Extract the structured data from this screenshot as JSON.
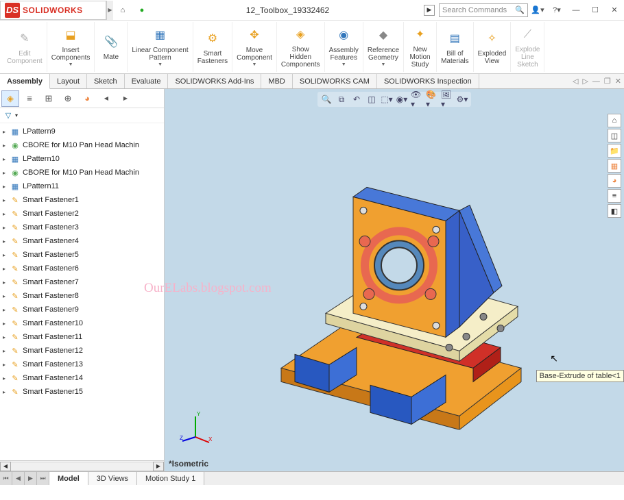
{
  "title": "12_Toolbox_19332462",
  "logo": {
    "text": "SOLIDWORKS"
  },
  "search_placeholder": "Search Commands",
  "ribbon": [
    {
      "label": "Edit\nComponent",
      "disabled": true
    },
    {
      "label": "Insert\nComponents"
    },
    {
      "label": "Mate"
    },
    {
      "label": "Linear Component\nPattern"
    },
    {
      "label": "Smart\nFasteners"
    },
    {
      "label": "Move\nComponent"
    },
    {
      "label": "Show\nHidden\nComponents"
    },
    {
      "label": "Assembly\nFeatures"
    },
    {
      "label": "Reference\nGeometry"
    },
    {
      "label": "New\nMotion\nStudy"
    },
    {
      "label": "Bill of\nMaterials"
    },
    {
      "label": "Exploded\nView"
    },
    {
      "label": "Explode\nLine\nSketch",
      "disabled": true
    }
  ],
  "cmdtabs": [
    "Assembly",
    "Layout",
    "Sketch",
    "Evaluate",
    "SOLIDWORKS Add-Ins",
    "MBD",
    "SOLIDWORKS CAM",
    "SOLIDWORKS Inspection"
  ],
  "tree": [
    {
      "icon": "pattern",
      "label": "LPattern9"
    },
    {
      "icon": "cbore",
      "label": "CBORE for M10 Pan Head Machin"
    },
    {
      "icon": "pattern",
      "label": "LPattern10"
    },
    {
      "icon": "cbore",
      "label": "CBORE for M10 Pan Head Machin"
    },
    {
      "icon": "pattern",
      "label": "LPattern11"
    },
    {
      "icon": "smart",
      "label": "Smart Fastener1"
    },
    {
      "icon": "smart",
      "label": "Smart Fastener2"
    },
    {
      "icon": "smart",
      "label": "Smart Fastener3"
    },
    {
      "icon": "smart",
      "label": "Smart Fastener4"
    },
    {
      "icon": "smart",
      "label": "Smart Fastener5"
    },
    {
      "icon": "smart",
      "label": "Smart Fastener6"
    },
    {
      "icon": "smart",
      "label": "Smart Fastener7"
    },
    {
      "icon": "smart",
      "label": "Smart Fastener8"
    },
    {
      "icon": "smart",
      "label": "Smart Fastener9"
    },
    {
      "icon": "smart",
      "label": "Smart Fastener10"
    },
    {
      "icon": "smart",
      "label": "Smart Fastener11"
    },
    {
      "icon": "smart",
      "label": "Smart Fastener12"
    },
    {
      "icon": "smart",
      "label": "Smart Fastener13"
    },
    {
      "icon": "smart",
      "label": "Smart Fastener14"
    },
    {
      "icon": "smart",
      "label": "Smart Fastener15"
    }
  ],
  "watermark": "OurELabs.blogspot.com",
  "viewlabel": "*Isometric",
  "tooltip": "Base-Extrude of table<1",
  "bottomtabs": [
    "Model",
    "3D Views",
    "Motion Study 1"
  ]
}
